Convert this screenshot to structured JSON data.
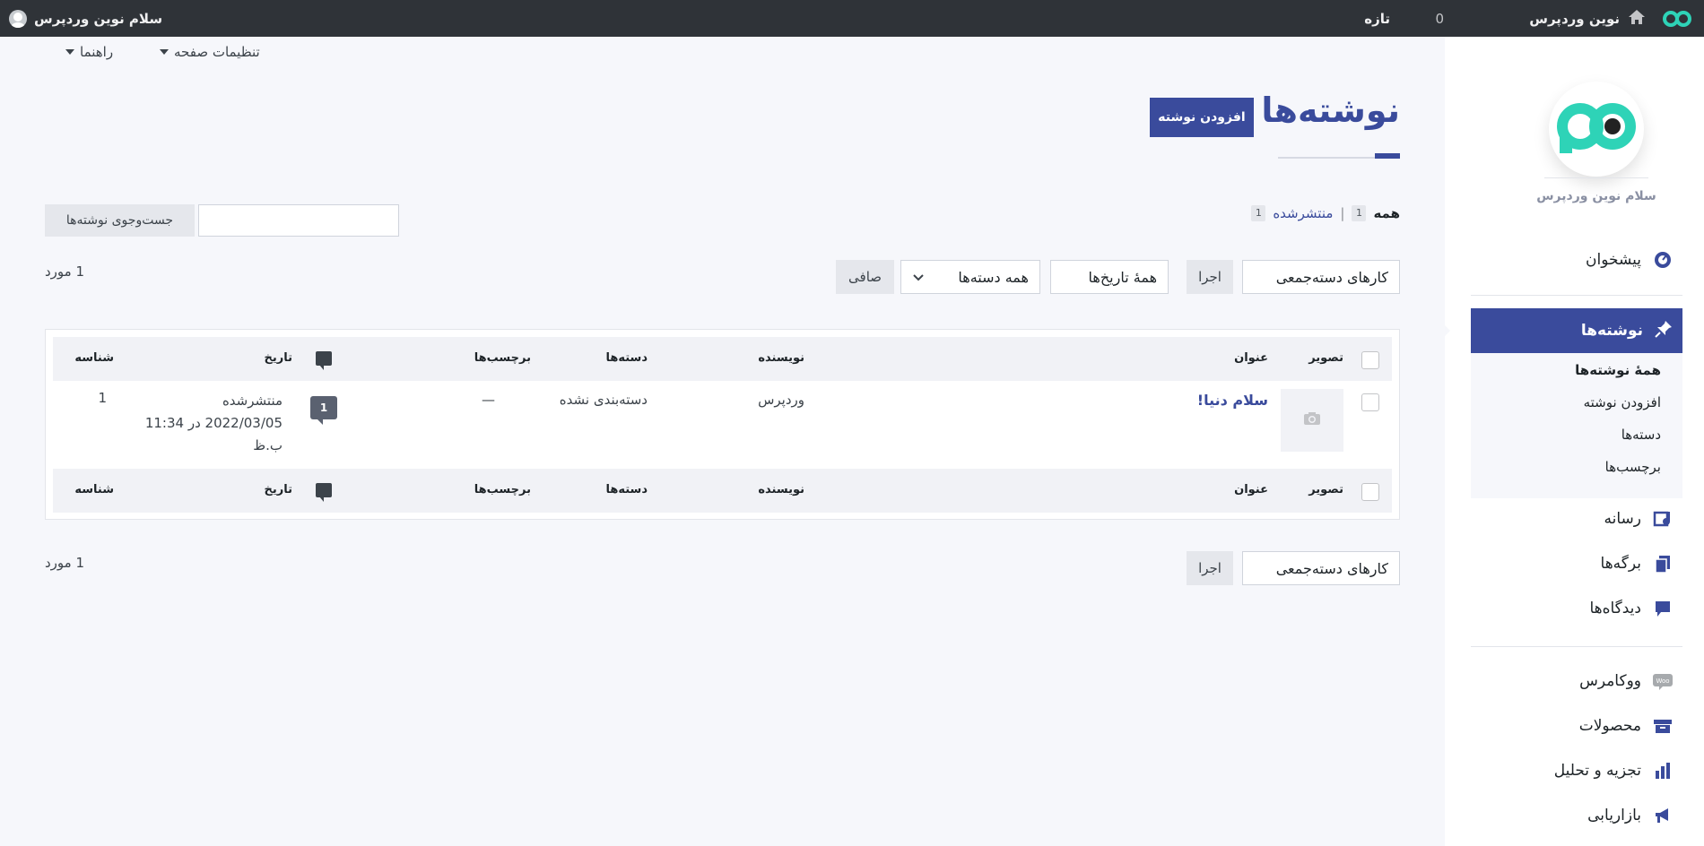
{
  "adminbar": {
    "site_name": "نوین وردپرس",
    "comments_count": "0",
    "new_label": "تازه",
    "greeting": "سلام نوین وردپرس"
  },
  "sidebar": {
    "site_name": "سلام نوین وردپرس",
    "items": [
      {
        "label": "پیشخوان",
        "icon": "dashboard-icon"
      },
      {
        "label": "نوشته‌ها",
        "icon": "pin-icon"
      },
      {
        "label": "رسانه",
        "icon": "media-icon"
      },
      {
        "label": "برگه‌ها",
        "icon": "pages-icon"
      },
      {
        "label": "دیدگاه‌ها",
        "icon": "comments-icon"
      },
      {
        "label": "ووکامرس",
        "icon": "woo-icon"
      },
      {
        "label": "محصولات",
        "icon": "products-icon"
      },
      {
        "label": "تجزیه و تحلیل",
        "icon": "analytics-icon"
      },
      {
        "label": "بازاریابی",
        "icon": "marketing-icon"
      }
    ],
    "submenu": [
      "همهٔ نوشته‌ها",
      "افزودن نوشته",
      "دسته‌ها",
      "برچسب‌ها"
    ],
    "accent_color": "#3a4b9c"
  },
  "header": {
    "screen_options": "تنظیمات صفحه",
    "help": "راهنما",
    "title": "نوشته‌ها",
    "add_new": "افزودن نوشته"
  },
  "filters": {
    "all_label": "همه",
    "all_count": "1",
    "published_label": "منتشرشده",
    "published_count": "1",
    "search_button": "جست‌وجوی نوشته‌ها",
    "search_value": ""
  },
  "tablenav": {
    "bulk_actions": "کارهای دسته‌جمعی",
    "apply": "اجرا",
    "all_dates": "همهٔ تاریخ‌ها",
    "all_categories": "همه دسته‌ها",
    "filter": "صافی",
    "items_count": "1 مورد"
  },
  "table": {
    "columns": {
      "thumb": "تصویر",
      "title": "عنوان",
      "author": "نویسنده",
      "categories": "دسته‌ها",
      "tags": "برچسب‌ها",
      "date": "تاریخ",
      "id": "شناسه"
    },
    "rows": [
      {
        "title": "سلام دنیا!",
        "author": "وردپرس",
        "categories": "دسته‌بندی نشده",
        "tags": "—",
        "comments": "1",
        "status": "منتشرشده",
        "date": "2022/03/05 در 11:34",
        "time_suffix": "ب.ظ",
        "id": "1"
      }
    ]
  }
}
